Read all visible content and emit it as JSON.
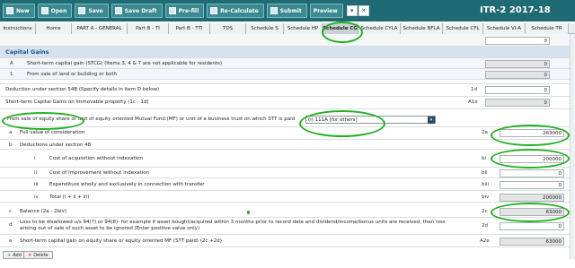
{
  "toolbar": {
    "buttons": [
      "New",
      "Open",
      "Save",
      "Save Draft",
      "Pre-fill",
      "Re-Calculate",
      "Submit",
      "Preview"
    ],
    "title": "ITR-2   2017-18"
  },
  "tabs": [
    "Instructions",
    "Home",
    "PART A - GENERAL",
    "Part B - TI",
    "Part B - TTI",
    "TDS",
    "Schedule S",
    "Schedule HP",
    "Schedule CG",
    "Schedule CYLA",
    "Schedule BFLA",
    "Schedule CFL",
    "Schedule VI-A",
    "Schedule TR"
  ],
  "section": {
    "title": "Capital Gains"
  },
  "rows": {
    "top_val": "0",
    "A": {
      "code": "A",
      "label": "Short-term capital gain (STCG) (Items 3, 4 & 7 are not applicable for residents)",
      "value": "0"
    },
    "one": {
      "code": "1",
      "label": "From sale of land or building or both",
      "value": "0"
    },
    "d": {
      "label": "Deduction under section 54B (Specify details in item D below)",
      "code": "1d",
      "value": "0"
    },
    "e": {
      "label": "Short-term Capital Gains on Immovable property (1c - 1d)",
      "code": "A1e",
      "value": "0"
    },
    "sale": {
      "label": "From sale of equity share or unit of equity oriented Mutual Fund (MF) or unit of a business trust on which STT is paid",
      "select": "(i) 111A [for others]"
    },
    "a": {
      "num": "a",
      "label": "Full value of consideration",
      "code": "2a",
      "value": "263000"
    },
    "b": {
      "num": "b",
      "label": "Deductions under section 48"
    },
    "bi": {
      "num": "i",
      "label": "Cost of acquisition without indexation",
      "code": "bi",
      "value": "200000"
    },
    "bii": {
      "num": "ii",
      "label": "Cost of Improvement without indexation",
      "code": "bii",
      "value": "0"
    },
    "biii": {
      "num": "iii",
      "label": "Expenditure wholly and exclusively in connection with transfer",
      "code": "biii",
      "value": "0"
    },
    "biv": {
      "num": "iv",
      "label": "Total (i + ii + iii)",
      "code": "biv",
      "value": "200000"
    },
    "c": {
      "num": "c",
      "label": "Balance (2a - 2biv)",
      "code": "2c",
      "value": "63000"
    },
    "dd": {
      "num": "d",
      "label": "Loss to be disallowed u/s 94(7) or 94(8)- for example if asset bought/acquired within 3 months prior to record date and dividend/income/bonus units are received, then loss arising out of sale of such asset to be ignored (Enter positive value only)",
      "code": "2d",
      "value": "0"
    },
    "ee": {
      "num": "e",
      "label": "Short-term capital gain on equity share or equity oriented MF (STT paid) (2c +2d)",
      "code": "A2e",
      "value": "63000"
    }
  },
  "actions": {
    "add": "Add",
    "delete": "Delete"
  }
}
